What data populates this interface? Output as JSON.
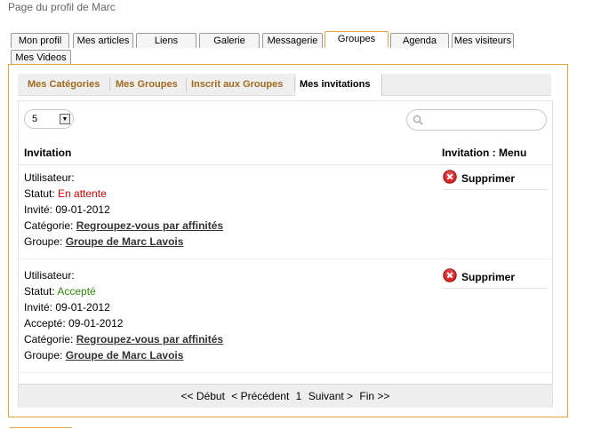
{
  "page": {
    "title": "Page du profil de Marc"
  },
  "tabs": [
    {
      "label": "Mon profil"
    },
    {
      "label": "Mes articles"
    },
    {
      "label": "Liens"
    },
    {
      "label": "Galerie"
    },
    {
      "label": "Messagerie"
    },
    {
      "label": "Groupes",
      "active": true
    },
    {
      "label": "Agenda"
    },
    {
      "label": "Mes visiteurs"
    },
    {
      "label": "Mes Videos"
    }
  ],
  "subtabs": [
    {
      "label": "Mes Catégories"
    },
    {
      "label": "Mes Groupes"
    },
    {
      "label": "Inscrit aux Groupes"
    },
    {
      "label": "Mes invitations",
      "active": true
    }
  ],
  "controls": {
    "per_page": "5",
    "per_page_arrow": "▼"
  },
  "table": {
    "headers": {
      "invitation": "Invitation",
      "menu": "Invitation : Menu"
    },
    "rows": [
      {
        "user_label": "Utilisateur:",
        "status_label": "Statut:",
        "status_value": "En attente",
        "invited_label": "Invité:",
        "invited_date": "09-01-2012",
        "category_label": "Catégorie:",
        "category_link": "Regroupez-vous par affinités",
        "group_label": "Groupe:",
        "group_link": "Groupe de Marc Lavois",
        "action": "Supprimer"
      },
      {
        "user_label": "Utilisateur:",
        "status_label": "Statut:",
        "status_value": "Accepté",
        "invited_label": "Invité:",
        "invited_date": "09-01-2012",
        "accepted_label": "Accepté:",
        "accepted_date": "09-01-2012",
        "category_label": "Catégorie:",
        "category_link": "Regroupez-vous par affinités",
        "group_label": "Groupe:",
        "group_link": "Groupe de Marc Lavois",
        "action": "Supprimer"
      }
    ]
  },
  "pager": {
    "first": "<< Début",
    "prev": "< Précédent",
    "current": "1",
    "next": "Suivant >",
    "last": "Fin >>"
  },
  "colors": {
    "accent": "#e0a63a",
    "subtab_text": "#a06a1e",
    "pending": "#d00000",
    "accepted": "#2a8a0a"
  },
  "icons": {
    "search": "search-icon",
    "delete": "delete-circle-icon",
    "dropdown": "chevron-down-icon"
  }
}
